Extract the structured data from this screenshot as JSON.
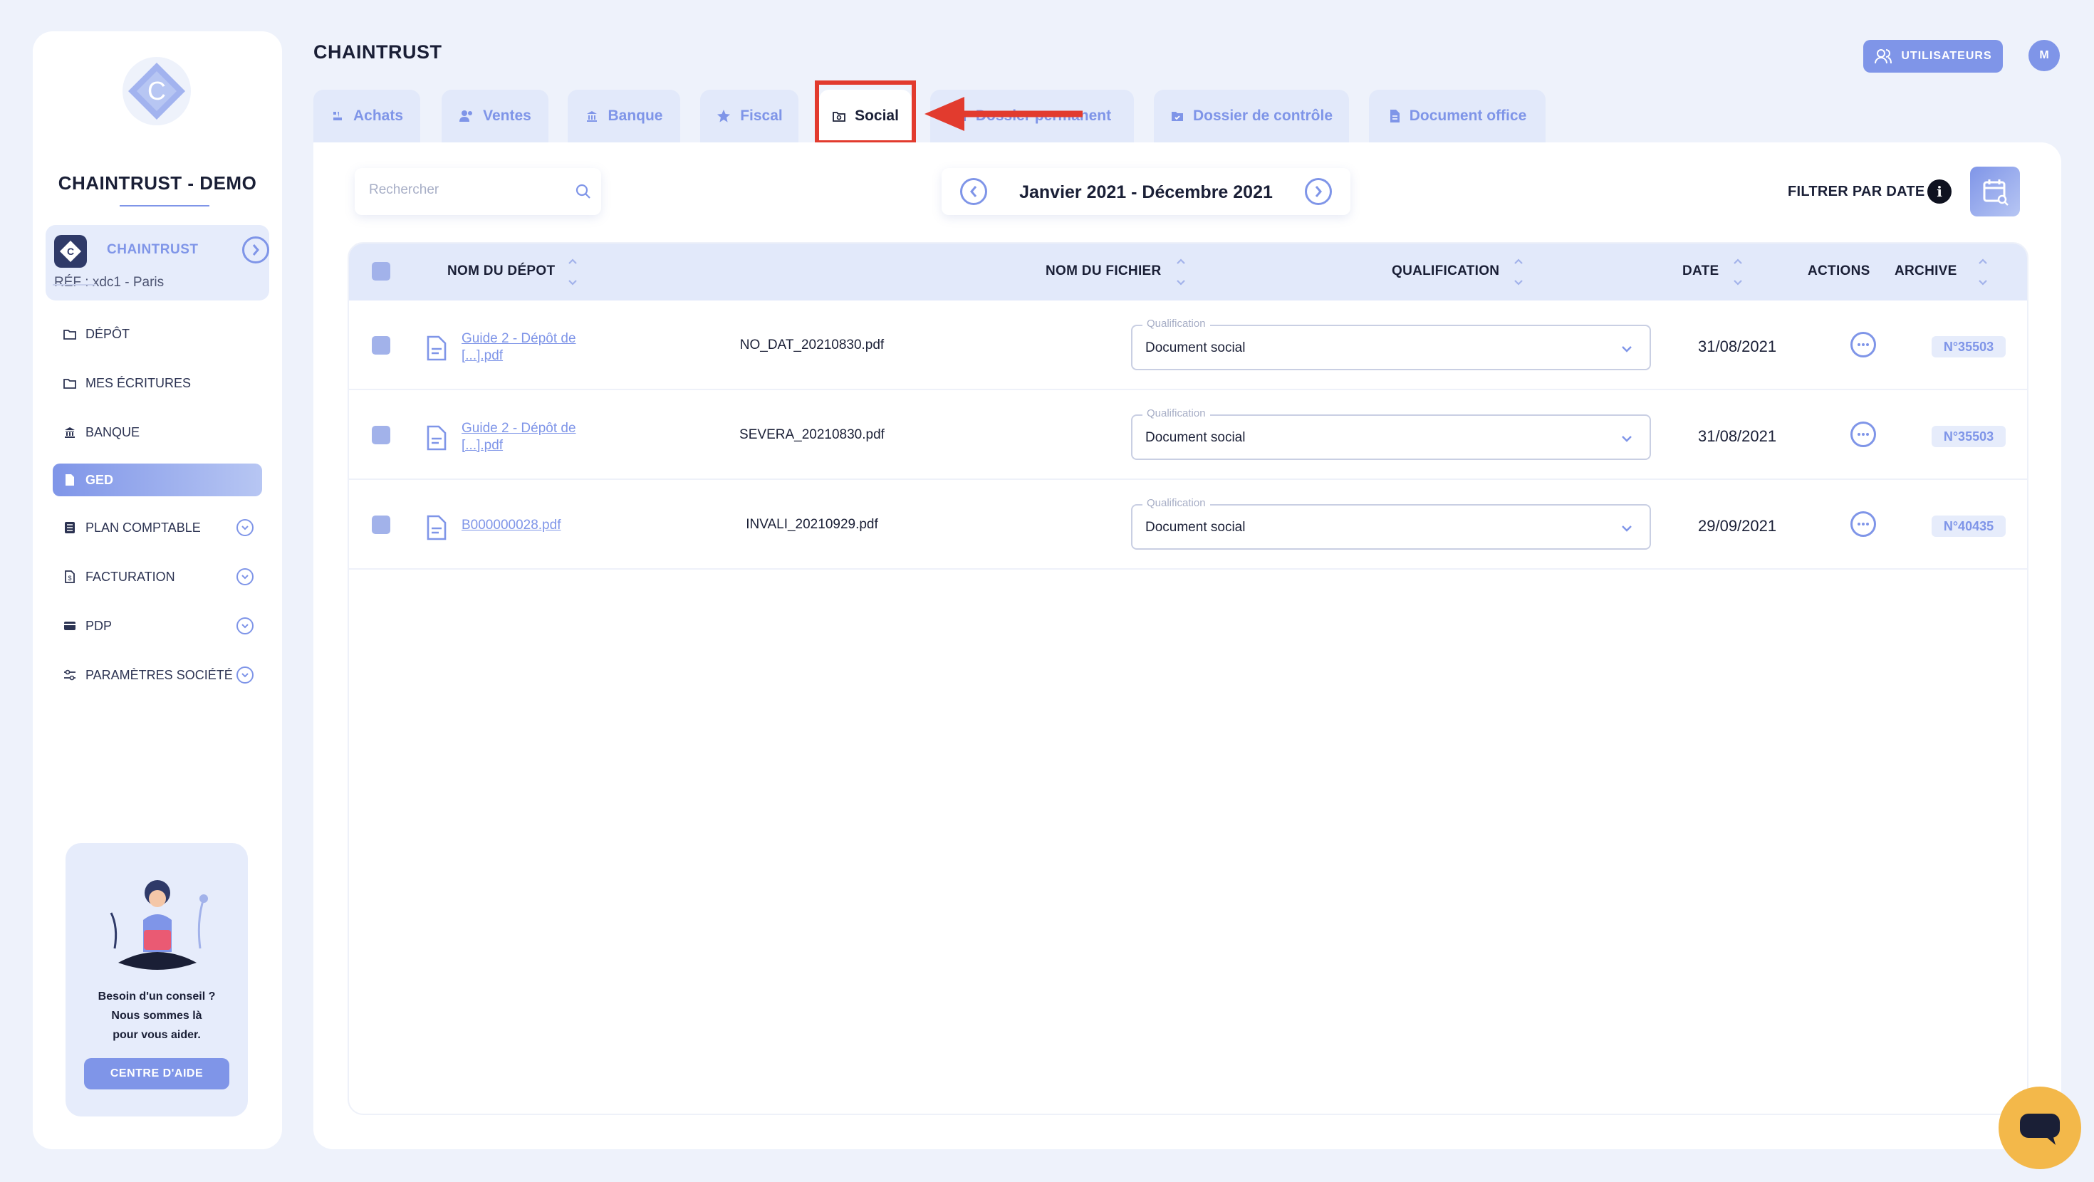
{
  "sidebar": {
    "company_name": "CHAINTRUST - DEMO",
    "company_card": {
      "name": "CHAINTRUST",
      "ref": "RÉF : xdc1 - Paris"
    },
    "nav": [
      {
        "label": "DÉPÔT",
        "icon": "folder-sync-icon",
        "expandable": false,
        "active": false
      },
      {
        "label": "MES ÉCRITURES",
        "icon": "folder-sync-icon",
        "expandable": false,
        "active": false
      },
      {
        "label": "BANQUE",
        "icon": "bank-icon",
        "expandable": false,
        "active": false
      },
      {
        "label": "GED",
        "icon": "document-icon",
        "expandable": false,
        "active": true
      },
      {
        "label": "PLAN COMPTABLE",
        "icon": "ledger-icon",
        "expandable": true,
        "active": false
      },
      {
        "label": "FACTURATION",
        "icon": "invoice-icon",
        "expandable": true,
        "active": false
      },
      {
        "label": "PDP",
        "icon": "card-icon",
        "expandable": true,
        "active": false
      },
      {
        "label": "PARAMÈTRES SOCIÉTÉ",
        "icon": "sliders-icon",
        "expandable": true,
        "active": false
      }
    ],
    "help": {
      "text": "Besoin d'un conseil ?\nNous sommes là\npour vous aider.",
      "button": "CENTRE D'AIDE"
    }
  },
  "header": {
    "title": "CHAINTRUST",
    "users_button": "UTILISATEURS",
    "user_initial": "M"
  },
  "tabs": [
    {
      "label": "Achats",
      "icon": "achats-icon"
    },
    {
      "label": "Ventes",
      "icon": "users-icon"
    },
    {
      "label": "Banque",
      "icon": "bank-icon"
    },
    {
      "label": "Fiscal",
      "icon": "star-icon"
    },
    {
      "label": "Social",
      "icon": "camera-folder-icon",
      "active": true
    },
    {
      "label": "Dossier permanent",
      "icon": "folder-icon"
    },
    {
      "label": "Dossier de contrôle",
      "icon": "folder-check-icon"
    },
    {
      "label": "Document office",
      "icon": "document-icon"
    }
  ],
  "toolbar": {
    "search_placeholder": "Rechercher",
    "date_range": "Janvier 2021 - Décembre 2021",
    "filter_label": "FILTRER PAR DATE",
    "info_glyph": "i"
  },
  "table": {
    "columns": {
      "depot": "NOM DU DÉPOT",
      "file": "NOM DU FICHIER",
      "qualification": "QUALIFICATION",
      "date": "DATE",
      "actions": "ACTIONS",
      "archive": "ARCHIVE"
    },
    "qualification_label": "Qualification",
    "rows": [
      {
        "depot_line1": "Guide 2 - Dépôt de",
        "depot_line2": "[...].pdf",
        "file": "NO_DAT_20210830.pdf",
        "qualification": "Document social",
        "date": "31/08/2021",
        "archive": "N°35503"
      },
      {
        "depot_line1": "Guide 2 - Dépôt de",
        "depot_line2": "[...].pdf",
        "file": "SEVERA_20210830.pdf",
        "qualification": "Document social",
        "date": "31/08/2021",
        "archive": "N°35503"
      },
      {
        "depot_line1": "B000000028.pdf",
        "depot_line2": "",
        "file": "INVALI_20210929.pdf",
        "qualification": "Document social",
        "date": "29/09/2021",
        "archive": "N°40435"
      }
    ]
  },
  "colors": {
    "accent": "#7f95e8",
    "highlight_annotation": "#e23b2e",
    "background": "#eef2fb",
    "chat": "#f3b84a"
  }
}
